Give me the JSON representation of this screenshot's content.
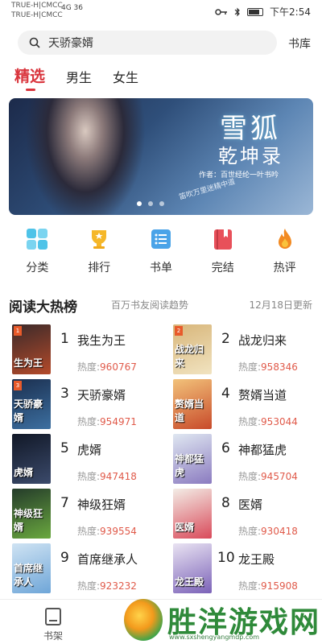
{
  "status_bar": {
    "carrier_1": "TRUE-H|CMCC",
    "carrier_2": "TRUE-H|CMCC",
    "network": "4G 36",
    "time": "下午2:54"
  },
  "search": {
    "value": "天骄豪婿",
    "shelf_link": "书库"
  },
  "tabs": [
    "精选",
    "男生",
    "女生"
  ],
  "banner": {
    "title_line1": "雪狐",
    "title_line2": "乾坤录",
    "author": "作者：百世经纶一叶书吟",
    "slogan": "笛吹万里迷精中道",
    "active_dot": 0
  },
  "quick_nav": [
    {
      "label": "分类",
      "icon": "category-grid-icon"
    },
    {
      "label": "排行",
      "icon": "trophy-icon"
    },
    {
      "label": "书单",
      "icon": "list-icon"
    },
    {
      "label": "完结",
      "icon": "bookmark-book-icon"
    },
    {
      "label": "热评",
      "icon": "flame-icon"
    }
  ],
  "hot_list": {
    "title": "阅读大热榜",
    "subtitle": "百万书友阅读趋势",
    "date": "12月18日更新",
    "heat_label": "热度:",
    "books": [
      {
        "rank": "1",
        "name": "我生为王",
        "heat": "960767",
        "cover_text": "生为王",
        "badge": "1",
        "colors": [
          "#3b2a2a",
          "#b44a2a"
        ]
      },
      {
        "rank": "2",
        "name": "战龙归来",
        "heat": "958346",
        "cover_text": "战龙归来",
        "badge": "2",
        "colors": [
          "#d8b67a",
          "#f1e3c0"
        ]
      },
      {
        "rank": "3",
        "name": "天骄豪婿",
        "heat": "954971",
        "cover_text": "天骄豪婿",
        "badge": "3",
        "colors": [
          "#1b2f4f",
          "#3c6fa0"
        ]
      },
      {
        "rank": "4",
        "name": "赘婿当道",
        "heat": "953044",
        "cover_text": "赘婿当道",
        "badge": "",
        "colors": [
          "#f2c27a",
          "#c84a2a"
        ]
      },
      {
        "rank": "5",
        "name": "虎婿",
        "heat": "947418",
        "cover_text": "虎婿",
        "badge": "",
        "colors": [
          "#111827",
          "#3b4a6b"
        ]
      },
      {
        "rank": "6",
        "name": "神都猛虎",
        "heat": "945704",
        "cover_text": "神都猛虎",
        "badge": "",
        "colors": [
          "#dfe7f1",
          "#8b7bc0"
        ]
      },
      {
        "rank": "7",
        "name": "神级狂婿",
        "heat": "939554",
        "cover_text": "神级狂婿",
        "badge": "",
        "colors": [
          "#243b2a",
          "#6aa83f"
        ]
      },
      {
        "rank": "8",
        "name": "医婿",
        "heat": "930418",
        "cover_text": "医婿",
        "badge": "",
        "colors": [
          "#f3ede6",
          "#d94a5a"
        ]
      },
      {
        "rank": "9",
        "name": "首席继承人",
        "heat": "923232",
        "cover_text": "首席继承人",
        "badge": "",
        "colors": [
          "#cfe3f3",
          "#6fa6d8"
        ]
      },
      {
        "rank": "10",
        "name": "龙王殿",
        "heat": "915908",
        "cover_text": "龙王殿",
        "badge": "",
        "colors": [
          "#e9e3f2",
          "#7b62b8"
        ]
      }
    ]
  },
  "bottom_nav": {
    "shelf": "书架"
  },
  "watermark": {
    "text": "胜洋游戏网",
    "url": "www.sxshengyangmdp.com"
  },
  "colors": {
    "accent": "#d9343c",
    "heat_value": "#e05a4a"
  }
}
